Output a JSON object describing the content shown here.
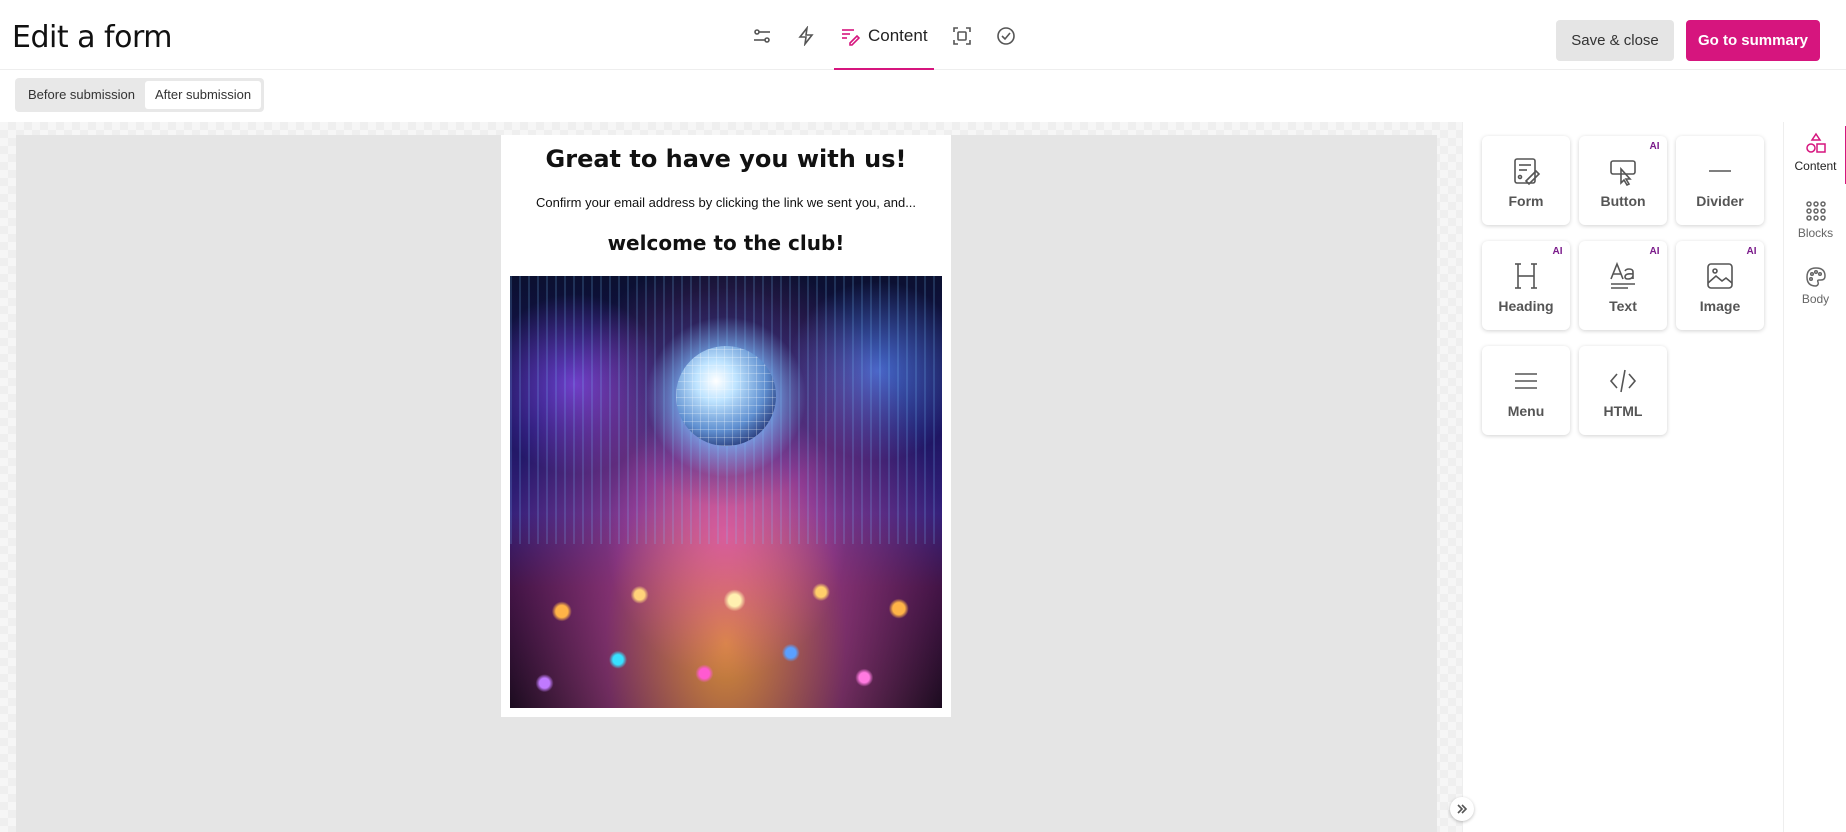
{
  "header": {
    "title": "Edit a form",
    "steps": [
      {
        "name": "settings",
        "icon": "sliders-icon"
      },
      {
        "name": "triggers",
        "icon": "lightning-icon"
      },
      {
        "name": "content",
        "label": "Content",
        "icon": "content-edit-icon",
        "active": true
      },
      {
        "name": "preview",
        "icon": "preview-frame-icon"
      },
      {
        "name": "summary",
        "icon": "check-circle-icon"
      }
    ],
    "save_close_label": "Save & close",
    "go_summary_label": "Go to summary"
  },
  "subbar": {
    "toggle": [
      "Before submission",
      "After submission"
    ],
    "selected": "After submission"
  },
  "email": {
    "heading": "Great to have you with us!",
    "body": "Confirm your email address by clicking the link we sent you, and...",
    "subheading": "welcome to the club!",
    "image_icon": "disco-party-image"
  },
  "panel": {
    "tiles": [
      {
        "label": "Form",
        "icon": "form-icon",
        "ai": false
      },
      {
        "label": "Button",
        "icon": "button-cursor-icon",
        "ai": true
      },
      {
        "label": "Divider",
        "icon": "divider-icon",
        "ai": false
      },
      {
        "label": "Heading",
        "icon": "heading-icon",
        "ai": true
      },
      {
        "label": "Text",
        "icon": "text-icon",
        "ai": true
      },
      {
        "label": "Image",
        "icon": "image-icon",
        "ai": true
      },
      {
        "label": "Menu",
        "icon": "menu-icon",
        "ai": false
      },
      {
        "label": "HTML",
        "icon": "code-icon",
        "ai": false
      }
    ],
    "ai_badge": "AI"
  },
  "rail": {
    "items": [
      {
        "label": "Content",
        "icon": "shapes-icon",
        "active": true
      },
      {
        "label": "Blocks",
        "icon": "grid-icon",
        "active": false
      },
      {
        "label": "Body",
        "icon": "palette-icon",
        "active": false
      }
    ]
  },
  "colors": {
    "accent": "#d6157e",
    "ai_badge": "#7a1a8a",
    "canvas_bg": "#e5e5e5"
  }
}
